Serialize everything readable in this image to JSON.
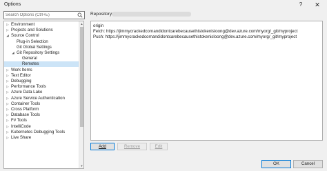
{
  "window": {
    "title": "Options",
    "help_glyph": "?",
    "close_glyph": "✕"
  },
  "search": {
    "placeholder": "Search Options (Ctrl+E)"
  },
  "tree": {
    "items": [
      {
        "label": "Environment",
        "level": 0,
        "expanded": false
      },
      {
        "label": "Projects and Solutions",
        "level": 0,
        "expanded": false
      },
      {
        "label": "Source Control",
        "level": 0,
        "expanded": true
      },
      {
        "label": "Plug-in Selection",
        "level": 1
      },
      {
        "label": "Git Global Settings",
        "level": 1
      },
      {
        "label": "Git Repository Settings",
        "level": 1,
        "expanded": true
      },
      {
        "label": "General",
        "level": 2
      },
      {
        "label": "Remotes",
        "level": 2,
        "selected": true
      },
      {
        "label": "Work Items",
        "level": 0,
        "expanded": false
      },
      {
        "label": "Text Editor",
        "level": 0,
        "expanded": false
      },
      {
        "label": "Debugging",
        "level": 0,
        "expanded": false
      },
      {
        "label": "Performance Tools",
        "level": 0,
        "expanded": false
      },
      {
        "label": "Azure Data Lake",
        "level": 0,
        "expanded": false
      },
      {
        "label": "Azure Service Authentication",
        "level": 0,
        "expanded": false
      },
      {
        "label": "Container Tools",
        "level": 0,
        "expanded": false
      },
      {
        "label": "Cross Platform",
        "level": 0,
        "expanded": false
      },
      {
        "label": "Database Tools",
        "level": 0,
        "expanded": false
      },
      {
        "label": "F# Tools",
        "level": 0,
        "expanded": false
      },
      {
        "label": "IntelliCode",
        "level": 0,
        "expanded": false
      },
      {
        "label": "Kubernetes Debugging Tools",
        "level": 0,
        "expanded": false
      },
      {
        "label": "Live Share",
        "level": 0,
        "expanded": false
      }
    ]
  },
  "repository": {
    "label": "Repository:"
  },
  "remotes": {
    "name": "origin",
    "fetch": "Fetch: https://jimmycrackedcornandidontcarebecausethistokenisloong@dev.azure.com/myorg/_git/myproject",
    "push": "Push: https://jimmycrackedcornandidontcarebecausethistokenisloong@dev.azure.com/myorg/_git/myproject"
  },
  "buttons": {
    "add": "Add",
    "remove": "Remove",
    "edit": "Edit",
    "ok": "OK",
    "cancel": "Cancel"
  },
  "colors": {
    "selection": "#cce4f7",
    "accent": "#0078d7"
  }
}
